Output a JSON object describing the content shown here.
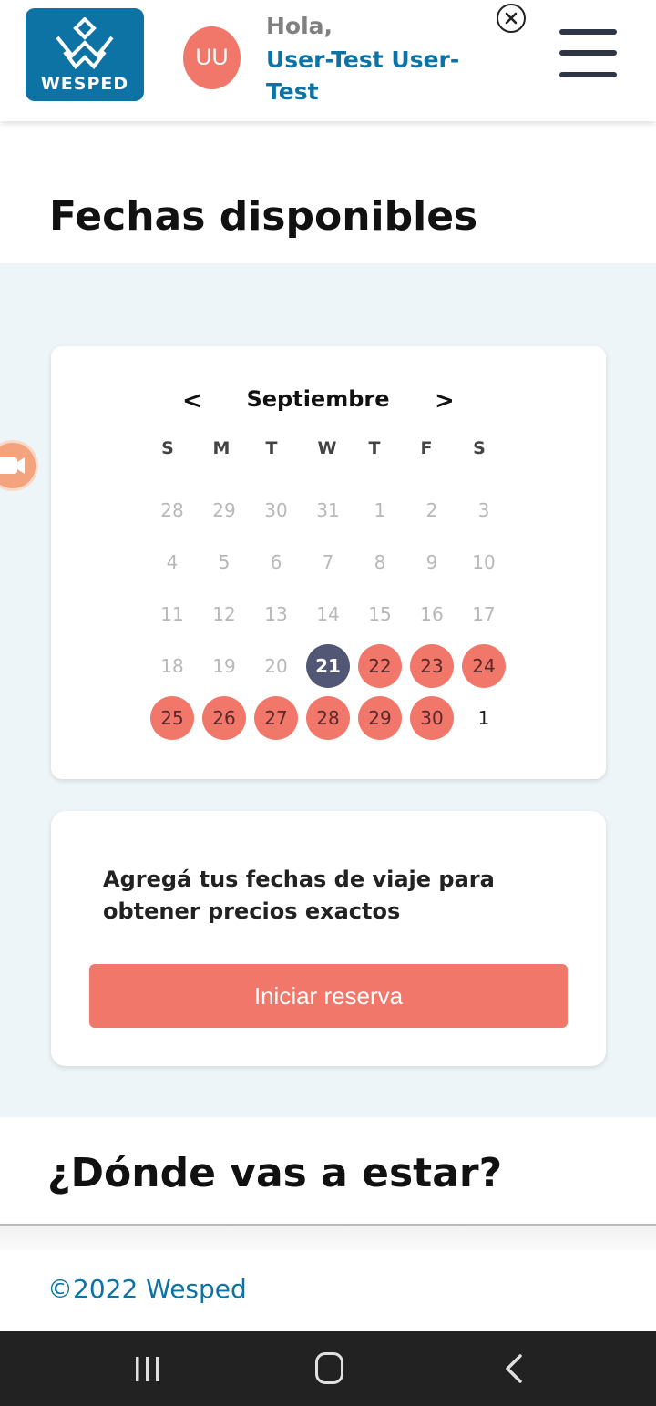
{
  "header": {
    "logo_text": "WESPED",
    "avatar_initials": "UU",
    "greeting": "Hola,",
    "user_name": "User-Test User-Test"
  },
  "availability": {
    "title": "Fechas disponibles",
    "calendar": {
      "prev_label": "<",
      "next_label": ">",
      "month": "Septiembre",
      "weekdays": [
        "S",
        "M",
        "T",
        "W",
        "T",
        "F",
        "S"
      ],
      "weeks": [
        [
          {
            "d": "28",
            "s": "past"
          },
          {
            "d": "29",
            "s": "past"
          },
          {
            "d": "30",
            "s": "past"
          },
          {
            "d": "31",
            "s": "past"
          },
          {
            "d": "1",
            "s": "past"
          },
          {
            "d": "2",
            "s": "past"
          },
          {
            "d": "3",
            "s": "past"
          }
        ],
        [
          {
            "d": "4",
            "s": "past"
          },
          {
            "d": "5",
            "s": "past"
          },
          {
            "d": "6",
            "s": "past"
          },
          {
            "d": "7",
            "s": "past"
          },
          {
            "d": "8",
            "s": "past"
          },
          {
            "d": "9",
            "s": "past"
          },
          {
            "d": "10",
            "s": "past"
          }
        ],
        [
          {
            "d": "11",
            "s": "past"
          },
          {
            "d": "12",
            "s": "past"
          },
          {
            "d": "13",
            "s": "past"
          },
          {
            "d": "14",
            "s": "past"
          },
          {
            "d": "15",
            "s": "past"
          },
          {
            "d": "16",
            "s": "past"
          },
          {
            "d": "17",
            "s": "past"
          }
        ],
        [
          {
            "d": "18",
            "s": "past"
          },
          {
            "d": "19",
            "s": "past"
          },
          {
            "d": "20",
            "s": "past"
          },
          {
            "d": "21",
            "s": "today"
          },
          {
            "d": "22",
            "s": "avail"
          },
          {
            "d": "23",
            "s": "avail"
          },
          {
            "d": "24",
            "s": "avail"
          }
        ],
        [
          {
            "d": "25",
            "s": "avail"
          },
          {
            "d": "26",
            "s": "avail"
          },
          {
            "d": "27",
            "s": "avail"
          },
          {
            "d": "28",
            "s": "avail"
          },
          {
            "d": "29",
            "s": "avail"
          },
          {
            "d": "30",
            "s": "avail"
          },
          {
            "d": "1",
            "s": "next"
          }
        ]
      ]
    },
    "info_text": "Agregá tus fechas de viaje para obtener precios exactos",
    "cta_label": "Iniciar reserva"
  },
  "location": {
    "title": "¿Dónde vas a estar?"
  },
  "footer": {
    "copyright": "©2022 Wesped"
  },
  "colors": {
    "brand_blue": "#0d73a5",
    "accent_coral": "#f0776a",
    "today_slate": "#525775",
    "band_bg": "#eef5f9"
  },
  "icons": [
    "wesped-logo-icon",
    "close-circle-icon",
    "hamburger-menu-icon",
    "video-camera-icon",
    "recent-apps-icon",
    "home-icon",
    "back-icon"
  ]
}
